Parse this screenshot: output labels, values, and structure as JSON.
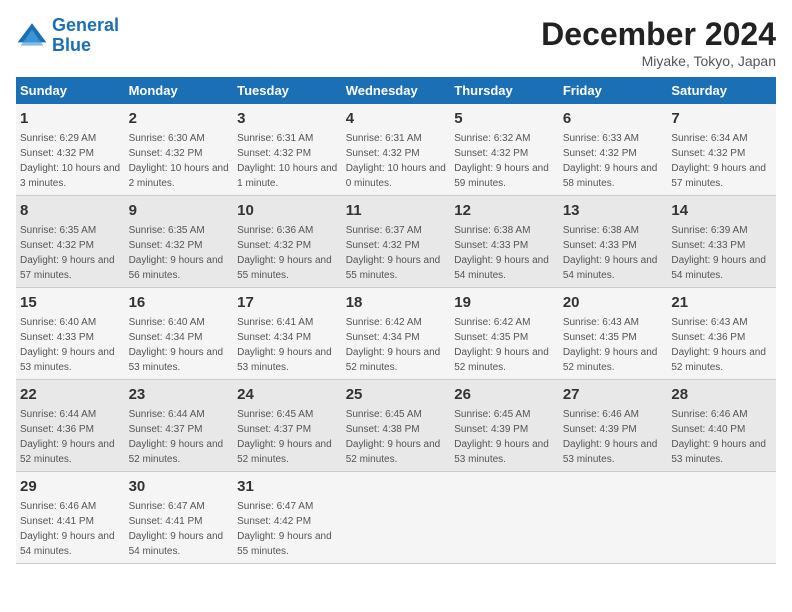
{
  "logo": {
    "line1": "General",
    "line2": "Blue"
  },
  "title": "December 2024",
  "subtitle": "Miyake, Tokyo, Japan",
  "header": {
    "days": [
      "Sunday",
      "Monday",
      "Tuesday",
      "Wednesday",
      "Thursday",
      "Friday",
      "Saturday"
    ]
  },
  "weeks": [
    [
      {
        "day": "1",
        "sunrise": "Sunrise: 6:29 AM",
        "sunset": "Sunset: 4:32 PM",
        "daylight": "Daylight: 10 hours and 3 minutes."
      },
      {
        "day": "2",
        "sunrise": "Sunrise: 6:30 AM",
        "sunset": "Sunset: 4:32 PM",
        "daylight": "Daylight: 10 hours and 2 minutes."
      },
      {
        "day": "3",
        "sunrise": "Sunrise: 6:31 AM",
        "sunset": "Sunset: 4:32 PM",
        "daylight": "Daylight: 10 hours and 1 minute."
      },
      {
        "day": "4",
        "sunrise": "Sunrise: 6:31 AM",
        "sunset": "Sunset: 4:32 PM",
        "daylight": "Daylight: 10 hours and 0 minutes."
      },
      {
        "day": "5",
        "sunrise": "Sunrise: 6:32 AM",
        "sunset": "Sunset: 4:32 PM",
        "daylight": "Daylight: 9 hours and 59 minutes."
      },
      {
        "day": "6",
        "sunrise": "Sunrise: 6:33 AM",
        "sunset": "Sunset: 4:32 PM",
        "daylight": "Daylight: 9 hours and 58 minutes."
      },
      {
        "day": "7",
        "sunrise": "Sunrise: 6:34 AM",
        "sunset": "Sunset: 4:32 PM",
        "daylight": "Daylight: 9 hours and 57 minutes."
      }
    ],
    [
      {
        "day": "8",
        "sunrise": "Sunrise: 6:35 AM",
        "sunset": "Sunset: 4:32 PM",
        "daylight": "Daylight: 9 hours and 57 minutes."
      },
      {
        "day": "9",
        "sunrise": "Sunrise: 6:35 AM",
        "sunset": "Sunset: 4:32 PM",
        "daylight": "Daylight: 9 hours and 56 minutes."
      },
      {
        "day": "10",
        "sunrise": "Sunrise: 6:36 AM",
        "sunset": "Sunset: 4:32 PM",
        "daylight": "Daylight: 9 hours and 55 minutes."
      },
      {
        "day": "11",
        "sunrise": "Sunrise: 6:37 AM",
        "sunset": "Sunset: 4:32 PM",
        "daylight": "Daylight: 9 hours and 55 minutes."
      },
      {
        "day": "12",
        "sunrise": "Sunrise: 6:38 AM",
        "sunset": "Sunset: 4:33 PM",
        "daylight": "Daylight: 9 hours and 54 minutes."
      },
      {
        "day": "13",
        "sunrise": "Sunrise: 6:38 AM",
        "sunset": "Sunset: 4:33 PM",
        "daylight": "Daylight: 9 hours and 54 minutes."
      },
      {
        "day": "14",
        "sunrise": "Sunrise: 6:39 AM",
        "sunset": "Sunset: 4:33 PM",
        "daylight": "Daylight: 9 hours and 54 minutes."
      }
    ],
    [
      {
        "day": "15",
        "sunrise": "Sunrise: 6:40 AM",
        "sunset": "Sunset: 4:33 PM",
        "daylight": "Daylight: 9 hours and 53 minutes."
      },
      {
        "day": "16",
        "sunrise": "Sunrise: 6:40 AM",
        "sunset": "Sunset: 4:34 PM",
        "daylight": "Daylight: 9 hours and 53 minutes."
      },
      {
        "day": "17",
        "sunrise": "Sunrise: 6:41 AM",
        "sunset": "Sunset: 4:34 PM",
        "daylight": "Daylight: 9 hours and 53 minutes."
      },
      {
        "day": "18",
        "sunrise": "Sunrise: 6:42 AM",
        "sunset": "Sunset: 4:34 PM",
        "daylight": "Daylight: 9 hours and 52 minutes."
      },
      {
        "day": "19",
        "sunrise": "Sunrise: 6:42 AM",
        "sunset": "Sunset: 4:35 PM",
        "daylight": "Daylight: 9 hours and 52 minutes."
      },
      {
        "day": "20",
        "sunrise": "Sunrise: 6:43 AM",
        "sunset": "Sunset: 4:35 PM",
        "daylight": "Daylight: 9 hours and 52 minutes."
      },
      {
        "day": "21",
        "sunrise": "Sunrise: 6:43 AM",
        "sunset": "Sunset: 4:36 PM",
        "daylight": "Daylight: 9 hours and 52 minutes."
      }
    ],
    [
      {
        "day": "22",
        "sunrise": "Sunrise: 6:44 AM",
        "sunset": "Sunset: 4:36 PM",
        "daylight": "Daylight: 9 hours and 52 minutes."
      },
      {
        "day": "23",
        "sunrise": "Sunrise: 6:44 AM",
        "sunset": "Sunset: 4:37 PM",
        "daylight": "Daylight: 9 hours and 52 minutes."
      },
      {
        "day": "24",
        "sunrise": "Sunrise: 6:45 AM",
        "sunset": "Sunset: 4:37 PM",
        "daylight": "Daylight: 9 hours and 52 minutes."
      },
      {
        "day": "25",
        "sunrise": "Sunrise: 6:45 AM",
        "sunset": "Sunset: 4:38 PM",
        "daylight": "Daylight: 9 hours and 52 minutes."
      },
      {
        "day": "26",
        "sunrise": "Sunrise: 6:45 AM",
        "sunset": "Sunset: 4:39 PM",
        "daylight": "Daylight: 9 hours and 53 minutes."
      },
      {
        "day": "27",
        "sunrise": "Sunrise: 6:46 AM",
        "sunset": "Sunset: 4:39 PM",
        "daylight": "Daylight: 9 hours and 53 minutes."
      },
      {
        "day": "28",
        "sunrise": "Sunrise: 6:46 AM",
        "sunset": "Sunset: 4:40 PM",
        "daylight": "Daylight: 9 hours and 53 minutes."
      }
    ],
    [
      {
        "day": "29",
        "sunrise": "Sunrise: 6:46 AM",
        "sunset": "Sunset: 4:41 PM",
        "daylight": "Daylight: 9 hours and 54 minutes."
      },
      {
        "day": "30",
        "sunrise": "Sunrise: 6:47 AM",
        "sunset": "Sunset: 4:41 PM",
        "daylight": "Daylight: 9 hours and 54 minutes."
      },
      {
        "day": "31",
        "sunrise": "Sunrise: 6:47 AM",
        "sunset": "Sunset: 4:42 PM",
        "daylight": "Daylight: 9 hours and 55 minutes."
      },
      {
        "day": "",
        "sunrise": "",
        "sunset": "",
        "daylight": ""
      },
      {
        "day": "",
        "sunrise": "",
        "sunset": "",
        "daylight": ""
      },
      {
        "day": "",
        "sunrise": "",
        "sunset": "",
        "daylight": ""
      },
      {
        "day": "",
        "sunrise": "",
        "sunset": "",
        "daylight": ""
      }
    ]
  ]
}
